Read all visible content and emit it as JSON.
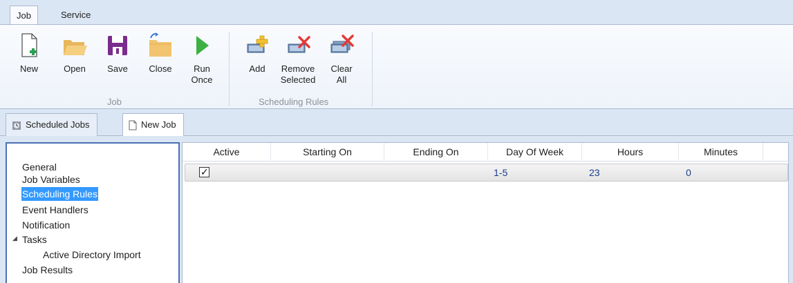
{
  "ribbon_tabs": [
    "Job",
    "Service"
  ],
  "ribbon": {
    "job_group": {
      "label": "Job",
      "buttons": {
        "new": "New",
        "open": "Open",
        "save": "Save",
        "close": "Close",
        "run_once_1": "Run",
        "run_once_2": "Once"
      }
    },
    "rules_group": {
      "label": "Scheduling Rules",
      "buttons": {
        "add": "Add",
        "remove_1": "Remove",
        "remove_2": "Selected",
        "clear_1": "Clear",
        "clear_2": "All"
      }
    }
  },
  "doc_tabs": [
    {
      "label": "Scheduled Jobs",
      "icon": "scheduled-jobs-icon"
    },
    {
      "label": "New Job",
      "icon": "document-icon"
    }
  ],
  "nav": {
    "items": [
      "General",
      "Job Variables",
      "Scheduling Rules",
      "Event Handlers",
      "Notification",
      "Tasks",
      "Active Directory Import",
      "Job Results"
    ],
    "selected": "Scheduling Rules"
  },
  "grid": {
    "columns": [
      "Active",
      "Starting On",
      "Ending On",
      "Day Of Week",
      "Hours",
      "Minutes"
    ],
    "rows": [
      {
        "active": true,
        "starting_on": "",
        "ending_on": "",
        "day_of_week": "1-5",
        "hours": "23",
        "minutes": "0",
        "check_glyph": "✓"
      }
    ]
  },
  "colors": {
    "accent": "#3399ff",
    "ribbon_bg": "#dbe6f4",
    "row_text": "#1b3c8c",
    "run_green": "#3cb043",
    "save_purple": "#7a2c8c",
    "delete_red": "#e53935"
  }
}
